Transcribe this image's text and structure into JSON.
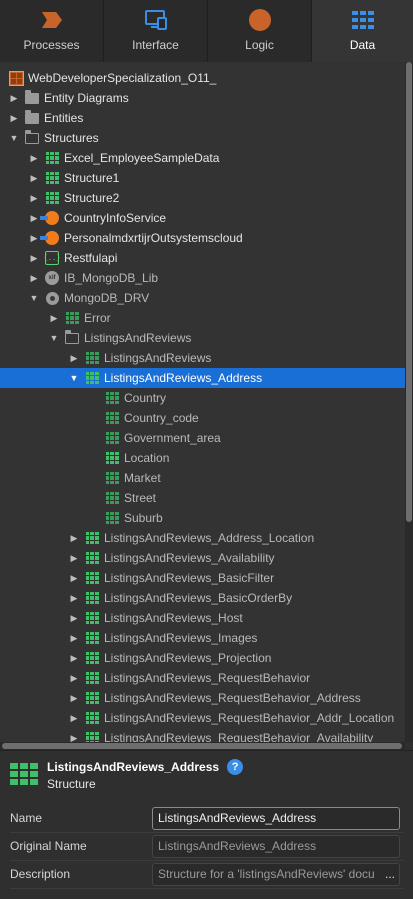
{
  "tabs": [
    {
      "label": "Processes",
      "icon": "processes-icon",
      "color": "#c8642a"
    },
    {
      "label": "Interface",
      "icon": "interface-icon",
      "color": "#3a8ee6"
    },
    {
      "label": "Logic",
      "icon": "logic-icon",
      "color": "#c8642a"
    },
    {
      "label": "Data",
      "icon": "data-icon",
      "color": "#3a8ee6",
      "active": true
    }
  ],
  "tree": {
    "root": "WebDeveloperSpecialization_O11_",
    "items": [
      {
        "label": "Entity Diagrams"
      },
      {
        "label": "Entities"
      },
      {
        "label": "Structures"
      },
      {
        "label": "Excel_EmployeeSampleData"
      },
      {
        "label": "Structure1"
      },
      {
        "label": "Structure2"
      },
      {
        "label": "CountryInfoService"
      },
      {
        "label": "PersonalmdxrtijrOutsystemscloud"
      },
      {
        "label": "Restfulapi"
      },
      {
        "label": "IB_MongoDB_Lib"
      },
      {
        "label": "MongoDB_DRV"
      },
      {
        "label": "Error"
      },
      {
        "label": "ListingsAndReviews"
      },
      {
        "label": "ListingsAndReviews"
      },
      {
        "label": "ListingsAndReviews_Address"
      },
      {
        "label": "Country"
      },
      {
        "label": "Country_code"
      },
      {
        "label": "Government_area"
      },
      {
        "label": "Location"
      },
      {
        "label": "Market"
      },
      {
        "label": "Street"
      },
      {
        "label": "Suburb"
      },
      {
        "label": "ListingsAndReviews_Address_Location"
      },
      {
        "label": "ListingsAndReviews_Availability"
      },
      {
        "label": "ListingsAndReviews_BasicFilter"
      },
      {
        "label": "ListingsAndReviews_BasicOrderBy"
      },
      {
        "label": "ListingsAndReviews_Host"
      },
      {
        "label": "ListingsAndReviews_Images"
      },
      {
        "label": "ListingsAndReviews_Projection"
      },
      {
        "label": "ListingsAndReviews_RequestBehavior"
      },
      {
        "label": "ListingsAndReviews_RequestBehavior_Address"
      },
      {
        "label": "ListingsAndReviews_RequestBehavior_Addr_Location"
      },
      {
        "label": "ListingsAndReviews_RequestBehavior_Availability"
      }
    ]
  },
  "properties": {
    "title": "ListingsAndReviews_Address",
    "kind": "Structure",
    "help": "?",
    "fields": [
      {
        "label": "Name",
        "value": "ListingsAndReviews_Address"
      },
      {
        "label": "Original Name",
        "value": "ListingsAndReviews_Address"
      },
      {
        "label": "Description",
        "value": "Structure for a 'listingsAndReviews' docu",
        "button": "..."
      }
    ]
  },
  "colors": {
    "selection": "#1a6fd6",
    "structure_green": "#3fbf6a"
  }
}
